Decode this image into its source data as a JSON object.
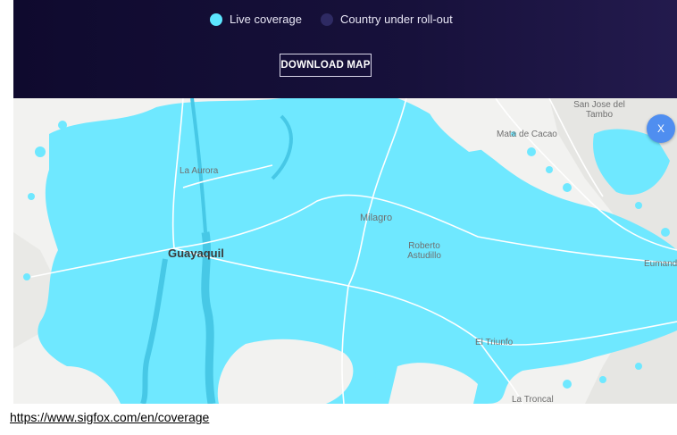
{
  "legend": {
    "live_label": "Live coverage",
    "rollout_label": "Country under roll-out"
  },
  "download_label": "DOWNLOAD MAP",
  "close_label": "X",
  "map": {
    "places": {
      "san_jose_del_tambo": "San Jose del Tambo",
      "mata_de_cacao": "Mata de Cacao",
      "la_aurora": "La Aurora",
      "milagro": "Milagro",
      "roberto_astudillo": "Roberto Astudillo",
      "guayaquil": "Guayaquil",
      "eumanda": "Eumanda",
      "el_triunfo": "El Triunfo",
      "la_troncal": "La Troncal"
    }
  },
  "caption": "https://www.sigfox.com/en/coverage",
  "colors": {
    "header_bg": "#150f36",
    "live_coverage": "#5ce6ff",
    "rollout": "#2e2a63",
    "map_bg": "#f2f2f0",
    "close_button": "#4f8ef0"
  }
}
